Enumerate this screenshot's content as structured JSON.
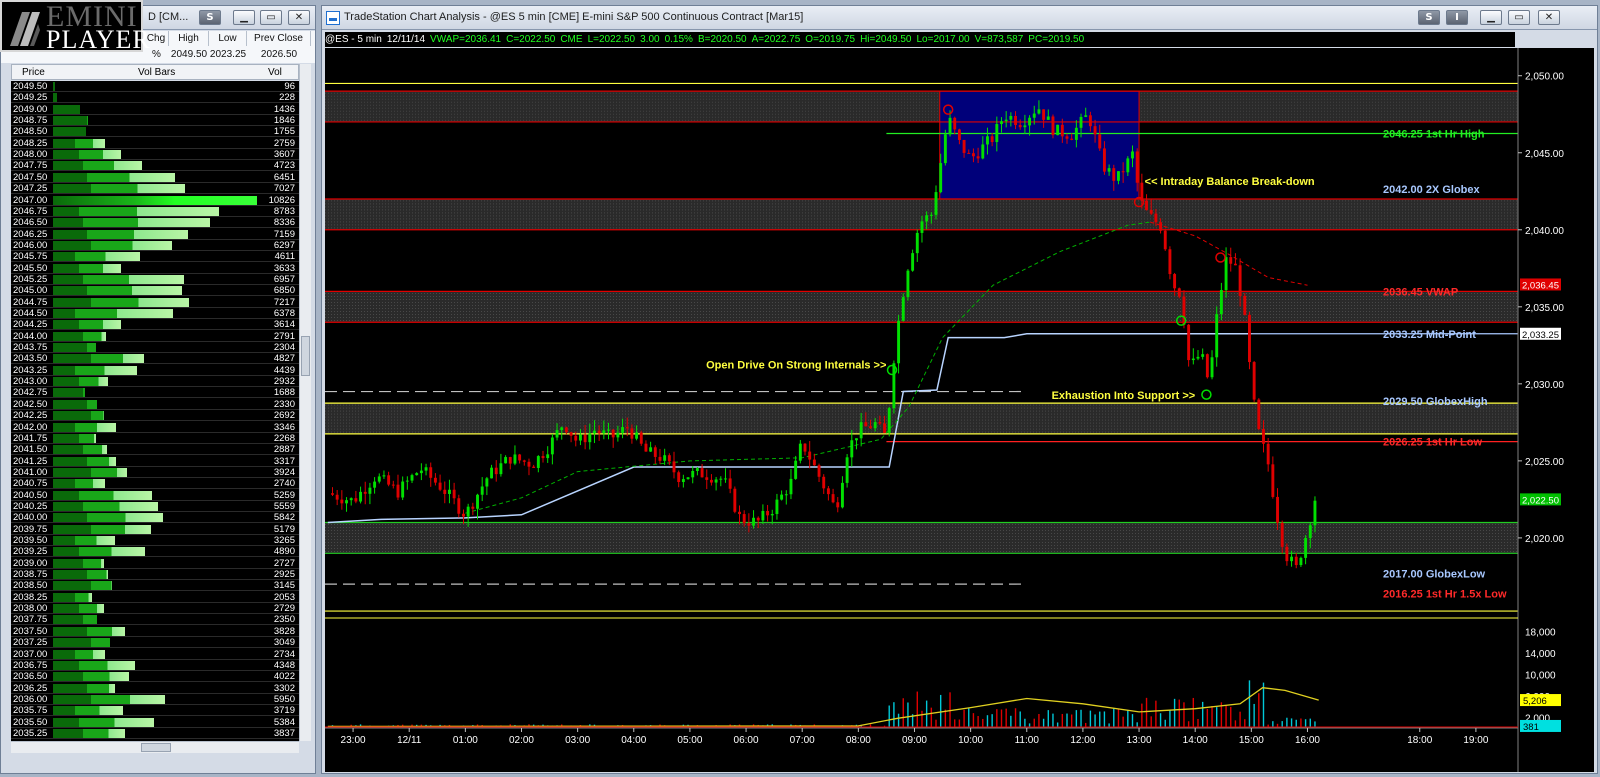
{
  "logo": {
    "line1": "EMINI",
    "line2": "PLAYER"
  },
  "left_window": {
    "title": "D [CM...",
    "header_cols": [
      "Chg",
      "High",
      "Low",
      "Prev Close"
    ],
    "header_vals": [
      "%",
      "2049.50",
      "2023.25",
      "2026.50"
    ],
    "table_headers": {
      "price": "Price",
      "bars": "Vol Bars",
      "vol": "Vol"
    },
    "rows": [
      {
        "price": "2049.50",
        "vol": "96"
      },
      {
        "price": "2049.25",
        "vol": "228"
      },
      {
        "price": "2049.00",
        "vol": "1436"
      },
      {
        "price": "2048.75",
        "vol": "1846"
      },
      {
        "price": "2048.50",
        "vol": "1755"
      },
      {
        "price": "2048.25",
        "vol": "2759"
      },
      {
        "price": "2048.00",
        "vol": "3607"
      },
      {
        "price": "2047.75",
        "vol": "4723"
      },
      {
        "price": "2047.50",
        "vol": "6451"
      },
      {
        "price": "2047.25",
        "vol": "7027"
      },
      {
        "price": "2047.00",
        "vol": "10826"
      },
      {
        "price": "2046.75",
        "vol": "8783"
      },
      {
        "price": "2046.50",
        "vol": "8336"
      },
      {
        "price": "2046.25",
        "vol": "7159"
      },
      {
        "price": "2046.00",
        "vol": "6297"
      },
      {
        "price": "2045.75",
        "vol": "4611"
      },
      {
        "price": "2045.50",
        "vol": "3633"
      },
      {
        "price": "2045.25",
        "vol": "6957"
      },
      {
        "price": "2045.00",
        "vol": "6850"
      },
      {
        "price": "2044.75",
        "vol": "7217"
      },
      {
        "price": "2044.50",
        "vol": "6378"
      },
      {
        "price": "2044.25",
        "vol": "3614"
      },
      {
        "price": "2044.00",
        "vol": "2791"
      },
      {
        "price": "2043.75",
        "vol": "2304"
      },
      {
        "price": "2043.50",
        "vol": "4827"
      },
      {
        "price": "2043.25",
        "vol": "4439"
      },
      {
        "price": "2043.00",
        "vol": "2932"
      },
      {
        "price": "2042.75",
        "vol": "1688"
      },
      {
        "price": "2042.50",
        "vol": "2330"
      },
      {
        "price": "2042.25",
        "vol": "2692"
      },
      {
        "price": "2042.00",
        "vol": "3346"
      },
      {
        "price": "2041.75",
        "vol": "2268"
      },
      {
        "price": "2041.50",
        "vol": "2887"
      },
      {
        "price": "2041.25",
        "vol": "3317"
      },
      {
        "price": "2041.00",
        "vol": "3924"
      },
      {
        "price": "2040.75",
        "vol": "2740"
      },
      {
        "price": "2040.50",
        "vol": "5259"
      },
      {
        "price": "2040.25",
        "vol": "5559"
      },
      {
        "price": "2040.00",
        "vol": "5842"
      },
      {
        "price": "2039.75",
        "vol": "5179"
      },
      {
        "price": "2039.50",
        "vol": "3265"
      },
      {
        "price": "2039.25",
        "vol": "4890"
      },
      {
        "price": "2039.00",
        "vol": "2727"
      },
      {
        "price": "2038.75",
        "vol": "2925"
      },
      {
        "price": "2038.50",
        "vol": "3145"
      },
      {
        "price": "2038.25",
        "vol": "2053"
      },
      {
        "price": "2038.00",
        "vol": "2729"
      },
      {
        "price": "2037.75",
        "vol": "2350"
      },
      {
        "price": "2037.50",
        "vol": "3828"
      },
      {
        "price": "2037.25",
        "vol": "3049"
      },
      {
        "price": "2037.00",
        "vol": "2734"
      },
      {
        "price": "2036.75",
        "vol": "4348"
      },
      {
        "price": "2036.50",
        "vol": "4022"
      },
      {
        "price": "2036.25",
        "vol": "3302"
      },
      {
        "price": "2036.00",
        "vol": "5950"
      },
      {
        "price": "2035.75",
        "vol": "3719"
      },
      {
        "price": "2035.50",
        "vol": "5384"
      },
      {
        "price": "2035.25",
        "vol": "3837"
      }
    ]
  },
  "chart_window": {
    "title": "TradeStation Chart Analysis - @ES 5 min [CME] E-mini S&P 500 Continuous Contract [Mar15]",
    "info": [
      "@ES - 5 min",
      "12/11/14",
      "VWAP=2036.41",
      "C=2022.50",
      "CME",
      "L=2022.50",
      "3.00",
      "0.15%",
      "B=2020.50",
      "A=2022.75",
      "O=2019.75",
      "Hi=2049.50",
      "Lo=2017.00",
      "V=873,587",
      "PC=2019.50"
    ],
    "colors": {
      "up": "#00e000",
      "down": "#e00000",
      "bg": "#000000",
      "vwap": "#00b000",
      "balance_box": "#00007a"
    }
  },
  "chart_data": {
    "type": "candlestick",
    "ylim": [
      2014.8,
      2051.8
    ],
    "yticks": [
      "2,050.00",
      "2,045.00",
      "2,040.00",
      "2,035.00",
      "2,030.00",
      "2,025.00",
      "2,020.00"
    ],
    "xticks": [
      "23:00",
      "12/11",
      "01:00",
      "02:00",
      "03:00",
      "04:00",
      "05:00",
      "06:00",
      "07:00",
      "08:00",
      "09:00",
      "10:00",
      "11:00",
      "12:00",
      "13:00",
      "14:00",
      "15:00",
      "16:00",
      "18:00",
      "19:00"
    ],
    "xlim_hours": [
      22.5,
      19.75
    ],
    "price_path": [
      [
        22.55,
        2022.9
      ],
      [
        23.0,
        2022.4
      ],
      [
        23.4,
        2024.0
      ],
      [
        23.8,
        2023.0
      ],
      [
        0.2,
        2024.5
      ],
      [
        0.6,
        2023.2
      ],
      [
        1.0,
        2021.5
      ],
      [
        1.4,
        2024.0
      ],
      [
        1.8,
        2025.2
      ],
      [
        2.2,
        2024.8
      ],
      [
        2.5,
        2026.0
      ],
      [
        2.75,
        2027.5
      ],
      [
        3.0,
        2026.2
      ],
      [
        3.3,
        2027.0
      ],
      [
        3.6,
        2026.5
      ],
      [
        3.9,
        2027.2
      ],
      [
        4.2,
        2025.6
      ],
      [
        4.5,
        2025.2
      ],
      [
        4.8,
        2024.0
      ],
      [
        5.2,
        2024.2
      ],
      [
        5.6,
        2023.8
      ],
      [
        5.9,
        2021.2
      ],
      [
        6.2,
        2021.0
      ],
      [
        6.5,
        2022.0
      ],
      [
        6.8,
        2023.6
      ],
      [
        7.0,
        2026.2
      ],
      [
        7.3,
        2024.0
      ],
      [
        7.6,
        2021.8
      ],
      [
        7.8,
        2025.6
      ],
      [
        8.0,
        2027.0
      ],
      [
        8.3,
        2027.4
      ],
      [
        8.5,
        2026.5
      ],
      [
        8.6,
        2030.8
      ],
      [
        8.75,
        2035.0
      ],
      [
        8.9,
        2038.0
      ],
      [
        9.1,
        2040.5
      ],
      [
        9.3,
        2041.0
      ],
      [
        9.45,
        2044.0
      ],
      [
        9.6,
        2047.3
      ],
      [
        9.8,
        2045.6
      ],
      [
        10.0,
        2044.6
      ],
      [
        10.2,
        2045.3
      ],
      [
        10.4,
        2046.0
      ],
      [
        10.6,
        2047.5
      ],
      [
        10.9,
        2047.0
      ],
      [
        11.2,
        2048.0
      ],
      [
        11.5,
        2046.4
      ],
      [
        11.8,
        2046.2
      ],
      [
        12.1,
        2047.5
      ],
      [
        12.35,
        2044.2
      ],
      [
        12.6,
        2043.2
      ],
      [
        12.9,
        2045.0
      ],
      [
        13.0,
        2042.0
      ],
      [
        13.15,
        2041.0
      ],
      [
        13.4,
        2040.2
      ],
      [
        13.6,
        2036.5
      ],
      [
        13.75,
        2035.8
      ],
      [
        13.9,
        2031.0
      ],
      [
        14.1,
        2032.0
      ],
      [
        14.25,
        2030.0
      ],
      [
        14.4,
        2034.8
      ],
      [
        14.55,
        2038.0
      ],
      [
        14.7,
        2037.8
      ],
      [
        14.85,
        2035.2
      ],
      [
        15.0,
        2030.0
      ],
      [
        15.1,
        2027.2
      ],
      [
        15.3,
        2024.8
      ],
      [
        15.45,
        2021.6
      ],
      [
        15.6,
        2019.0
      ],
      [
        15.8,
        2018.0
      ],
      [
        16.0,
        2020.5
      ],
      [
        16.15,
        2022.8
      ]
    ],
    "lines": [
      {
        "price": 2049.5,
        "color": "#ffff40",
        "label": ""
      },
      {
        "price": 2049.0,
        "color": "#e00000",
        "label": ""
      },
      {
        "price": 2047.0,
        "color": "#e00000",
        "label": ""
      },
      {
        "price": 2046.25,
        "color": "#22ee22",
        "label": "2046.25 1st Hr  High",
        "label_color": "#22ee22",
        "x_start": 8.5
      },
      {
        "price": 2042.0,
        "color": "#e00000",
        "label": "2042.00 2X Globex",
        "label_color": "#a8c8ff"
      },
      {
        "price": 2040.0,
        "color": "#e00000",
        "label": ""
      },
      {
        "price": 2036.0,
        "color": "#e00000",
        "label": "2036.45 VWAP",
        "label_color": "#ff2a2a"
      },
      {
        "price": 2034.0,
        "color": "#e00000",
        "label": ""
      },
      {
        "price": 2033.25,
        "color": "#a8c8ff",
        "label": "2033.25 Mid-Point",
        "label_color": "#a8c8ff",
        "x_start": 13.0
      },
      {
        "price": 2028.75,
        "color": "#ffff40",
        "label": "2029.50 GlobexHigh",
        "label_color": "#a8c8ff"
      },
      {
        "price": 2026.75,
        "color": "#ffff40",
        "label": ""
      },
      {
        "price": 2026.25,
        "color": "#ff2020",
        "label": "2026.25 1st Hr  Low",
        "label_color": "#ff2a2a",
        "x_start": 8.5
      },
      {
        "price": 2021.0,
        "color": "#22cc22",
        "label": ""
      },
      {
        "price": 2019.0,
        "color": "#22cc22",
        "label": ""
      },
      {
        "price": 2015.25,
        "color": "#ffff40",
        "label": ""
      }
    ],
    "dashed_lines": [
      {
        "price": 2029.5,
        "x_end": 11.0,
        "color": "#c0c0c0"
      },
      {
        "price": 2017.0,
        "x_end": 11.0,
        "color": "#c0c0c0"
      }
    ],
    "bottom_labels": [
      {
        "text": "2017.00 GlobexLow",
        "color": "#a8c8ff",
        "price": 2017.7
      },
      {
        "text": "2016.25 1st Hr  1.5x Low",
        "color": "#ff2a2a",
        "price": 2016.4
      }
    ],
    "annotations": [
      {
        "text": "<< Intraday Balance Break-down",
        "color": "#ffff40",
        "x": 13.1,
        "price": 2042.9
      },
      {
        "text": "Open Drive On Strong Internals >>",
        "color": "#ffff40",
        "x": 8.5,
        "price": 2031.0,
        "anchor": "end"
      },
      {
        "text": "Exhaustion Into Support >>",
        "color": "#ffff40",
        "x": 14.0,
        "price": 2029.0,
        "anchor": "end"
      }
    ],
    "balance_box": {
      "x0": 9.45,
      "x1": 13.0,
      "p0": 2049.0,
      "p1": 2042.0
    },
    "axis_tags": [
      {
        "text": "2,036.45",
        "price": 2036.45,
        "bg": "#e00000",
        "fg": "#ffffff"
      },
      {
        "text": "2,033.25",
        "price": 2033.25,
        "bg": "#ffffff",
        "fg": "#000000"
      },
      {
        "text": "2,022.50",
        "price": 2022.5,
        "bg": "#00c000",
        "fg": "#ffffff"
      }
    ],
    "volume_yticks": [
      "18,000",
      "14,000",
      "10,000",
      "6,000",
      "2,000"
    ],
    "volume_tags": [
      {
        "text": "5,206",
        "bg": "#ffff00",
        "fg": "#000000"
      },
      {
        "text": "381",
        "bg": "#00e0e0",
        "fg": "#000000"
      }
    ]
  }
}
